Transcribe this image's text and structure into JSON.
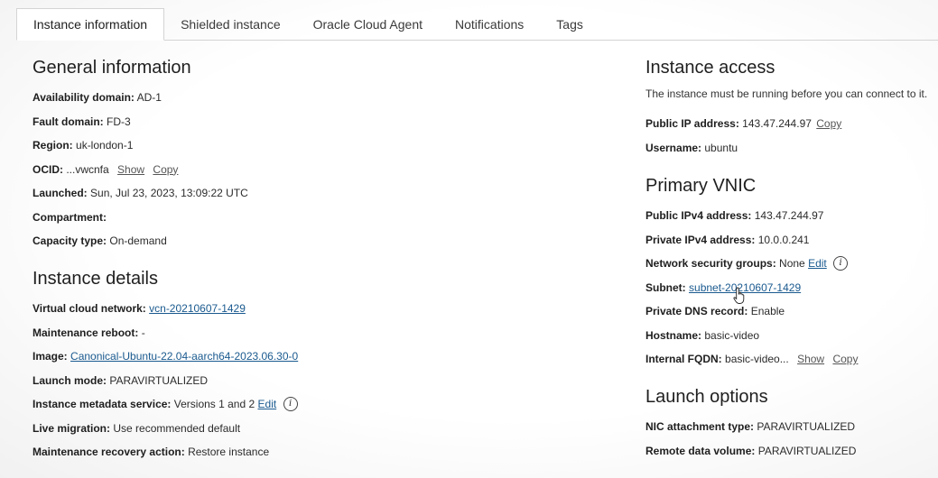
{
  "tabs": [
    {
      "label": "Instance information"
    },
    {
      "label": "Shielded instance"
    },
    {
      "label": "Oracle Cloud Agent"
    },
    {
      "label": "Notifications"
    },
    {
      "label": "Tags"
    }
  ],
  "general": {
    "title": "General information",
    "availability_domain": {
      "label": "Availability domain:",
      "value": "AD-1"
    },
    "fault_domain": {
      "label": "Fault domain:",
      "value": "FD-3"
    },
    "region": {
      "label": "Region:",
      "value": "uk-london-1"
    },
    "ocid": {
      "label": "OCID:",
      "value": "...vwcnfa",
      "show": "Show",
      "copy": "Copy"
    },
    "launched": {
      "label": "Launched:",
      "value": "Sun, Jul 23, 2023, 13:09:22 UTC"
    },
    "compartment": {
      "label": "Compartment:",
      "value": ""
    },
    "capacity_type": {
      "label": "Capacity type:",
      "value": "On-demand"
    }
  },
  "details": {
    "title": "Instance details",
    "vcn": {
      "label": "Virtual cloud network:",
      "value": "vcn-20210607-1429"
    },
    "maintenance_reboot": {
      "label": "Maintenance reboot:",
      "value": "-"
    },
    "image": {
      "label": "Image:",
      "value": "Canonical-Ubuntu-22.04-aarch64-2023.06.30-0"
    },
    "launch_mode": {
      "label": "Launch mode:",
      "value": "PARAVIRTUALIZED"
    },
    "metadata_service": {
      "label": "Instance metadata service:",
      "value": "Versions 1 and 2",
      "edit": "Edit",
      "info": "i"
    },
    "live_migration": {
      "label": "Live migration:",
      "value": "Use recommended default"
    },
    "maintenance_recovery": {
      "label": "Maintenance recovery action:",
      "value": "Restore instance"
    }
  },
  "access": {
    "title": "Instance access",
    "description": "The instance must be running before you can connect to it.",
    "public_ip": {
      "label": "Public IP address:",
      "value": "143.47.244.97",
      "copy": "Copy"
    },
    "username": {
      "label": "Username:",
      "value": "ubuntu"
    }
  },
  "vnic": {
    "title": "Primary VNIC",
    "public_ipv4": {
      "label": "Public IPv4 address:",
      "value": "143.47.244.97"
    },
    "private_ipv4": {
      "label": "Private IPv4 address:",
      "value": "10.0.0.241"
    },
    "nsg": {
      "label": "Network security groups:",
      "value": "None",
      "edit": "Edit",
      "info": "i"
    },
    "subnet": {
      "label": "Subnet:",
      "value": "subnet-20210607-1429"
    },
    "private_dns": {
      "label": "Private DNS record:",
      "value": "Enable"
    },
    "hostname": {
      "label": "Hostname:",
      "value": "basic-video"
    },
    "internal_fqdn": {
      "label": "Internal FQDN:",
      "value": "basic-video...",
      "show": "Show",
      "copy": "Copy"
    }
  },
  "launch": {
    "title": "Launch options",
    "nic_type": {
      "label": "NIC attachment type:",
      "value": "PARAVIRTUALIZED"
    },
    "remote_volume": {
      "label": "Remote data volume:",
      "value": "PARAVIRTUALIZED"
    }
  }
}
